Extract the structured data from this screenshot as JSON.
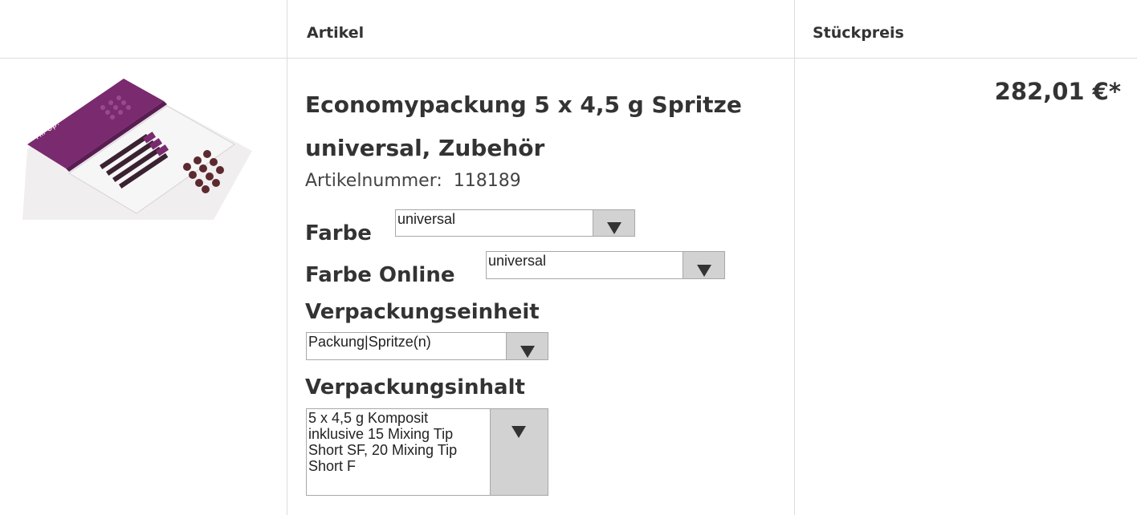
{
  "header": {
    "col_article": "Artikel",
    "col_price": "Stückpreis"
  },
  "product": {
    "title_line1": "Economypackung 5 x 4,5 g Spritze",
    "title_line2": "universal, Zubehör",
    "article_number_label": "Artikelnummer:",
    "article_number": "118189",
    "price": "282,01 €*",
    "image_icon": "product-package-image",
    "image_text": "Fill-Up!"
  },
  "options": {
    "farbe": {
      "label": "Farbe",
      "value": "universal"
    },
    "farbe_online": {
      "label": "Farbe Online",
      "value": "universal"
    },
    "verpackungseinheit": {
      "label": "Verpackungseinheit",
      "value": "Packung|Spritze(n)"
    },
    "verpackungsinhalt": {
      "label": "Verpackungsinhalt",
      "value_lines": [
        "5 x 4,5 g Komposit",
        "inklusive 15 Mixing Tip",
        "Short SF, 20 Mixing Tip",
        "Short F"
      ]
    }
  },
  "colors": {
    "accent_purple": "#7a2a6e",
    "border": "#dcdcdc",
    "select_button": "#d2d2d2"
  }
}
